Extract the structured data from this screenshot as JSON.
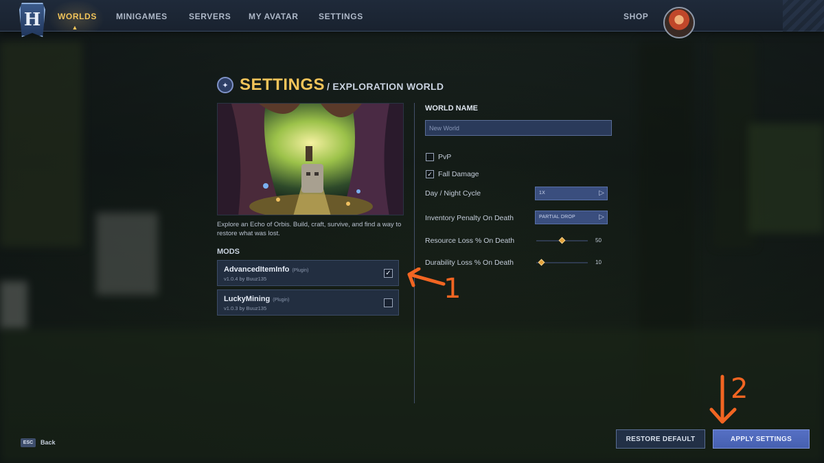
{
  "nav": {
    "items": [
      {
        "label": "WORLDS",
        "active": true
      },
      {
        "label": "MINIGAMES",
        "active": false
      },
      {
        "label": "SERVERS",
        "active": false
      },
      {
        "label": "MY AVATAR",
        "active": false
      },
      {
        "label": "SETTINGS",
        "active": false
      }
    ],
    "shop_label": "SHOP",
    "logo_letter": "H"
  },
  "header": {
    "title": "SETTINGS",
    "subtitle": "/ EXPLORATION WORLD"
  },
  "world": {
    "description": "Explore an Echo of Orbis. Build, craft, survive, and find a way to restore what was lost."
  },
  "mods": {
    "heading": "MODS",
    "items": [
      {
        "name": "AdvancedItemInfo",
        "tag": "(Plugin)",
        "meta": "v1.0.4 by Buuz135",
        "checked": true
      },
      {
        "name": "LuckyMining",
        "tag": "(Plugin)",
        "meta": "v1.0.3 by Buuz135",
        "checked": false
      }
    ]
  },
  "settings": {
    "world_name_heading": "WORLD NAME",
    "world_name_placeholder": "New World",
    "pvp": {
      "label": "PvP",
      "checked": false
    },
    "fall_damage": {
      "label": "Fall Damage",
      "checked": true
    },
    "day_night": {
      "label": "Day / Night Cycle",
      "value": "1X"
    },
    "inventory_penalty": {
      "label": "Inventory Penalty On Death",
      "value": "PARTIAL DROP"
    },
    "resource_loss": {
      "label": "Resource Loss % On Death",
      "value": "50",
      "level": 0.5
    },
    "durability_loss": {
      "label": "Durability Loss % On Death",
      "value": "10",
      "level": 0.1
    }
  },
  "annotations": {
    "one": "1",
    "two": "2"
  },
  "footer": {
    "esc_key": "ESC",
    "back_label": "Back",
    "restore_label": "RESTORE DEFAULT",
    "apply_label": "APPLY SETTINGS"
  },
  "colors": {
    "accent_gold": "#f2c45a",
    "annotation_orange": "#f26522",
    "apply_blue": "#5670c4"
  }
}
